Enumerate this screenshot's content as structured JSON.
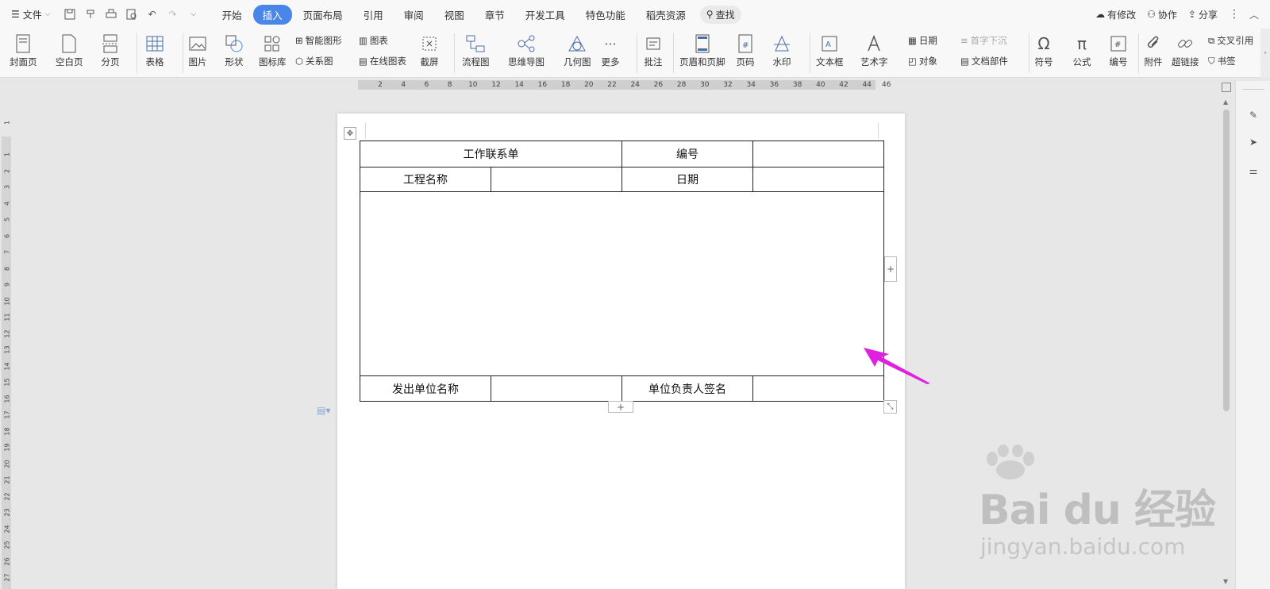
{
  "menubar": {
    "file_label": "文件",
    "tabs": [
      "开始",
      "插入",
      "页面布局",
      "引用",
      "审阅",
      "视图",
      "章节",
      "开发工具",
      "特色功能",
      "稻壳资源"
    ],
    "active_tab": "插入",
    "search_label": "查找",
    "right": [
      "有修改",
      "协作",
      "分享"
    ]
  },
  "ribbon": {
    "big": [
      "封面页",
      "空白页",
      "分页",
      "表格",
      "图片",
      "形状",
      "图标库",
      "截屏",
      "流程图",
      "思维导图",
      "几何图",
      "更多",
      "批注",
      "页眉和页脚",
      "页码",
      "水印",
      "文本框",
      "艺术字",
      "符号",
      "公式",
      "编号",
      "附件",
      "超链接"
    ],
    "small": [
      "智能图形",
      "关系图",
      "图表",
      "在线图表",
      "日期",
      "首字下沉",
      "对象",
      "文档部件",
      "交叉引用",
      "书签"
    ]
  },
  "ruler": {
    "h_ticks": [
      "2",
      "4",
      "6",
      "8",
      "10",
      "12",
      "14",
      "16",
      "18",
      "20",
      "22",
      "24",
      "26",
      "28",
      "30",
      "32",
      "34",
      "36",
      "38",
      "40",
      "42",
      "44"
    ],
    "h_end": "46",
    "v_ticks": [
      "1",
      "1",
      "2",
      "3",
      "4",
      "5",
      "6",
      "7",
      "8",
      "9",
      "10",
      "11",
      "12",
      "13",
      "14",
      "15",
      "16",
      "17",
      "18",
      "19",
      "20",
      "21",
      "22",
      "23",
      "24",
      "25",
      "26",
      "27"
    ]
  },
  "form_table": {
    "row1": [
      "工作联系单",
      "编号",
      ""
    ],
    "row2": [
      "工程名称",
      "",
      "日期",
      ""
    ],
    "row3": [
      ""
    ],
    "row4": [
      "发出单位名称",
      "",
      "单位负责人签名",
      ""
    ]
  },
  "watermark": {
    "text": "Bai du 经验",
    "sub": "jingyan.baidu.com"
  },
  "colors": {
    "accent": "#4a86e8",
    "arrow": "#e020e0"
  }
}
